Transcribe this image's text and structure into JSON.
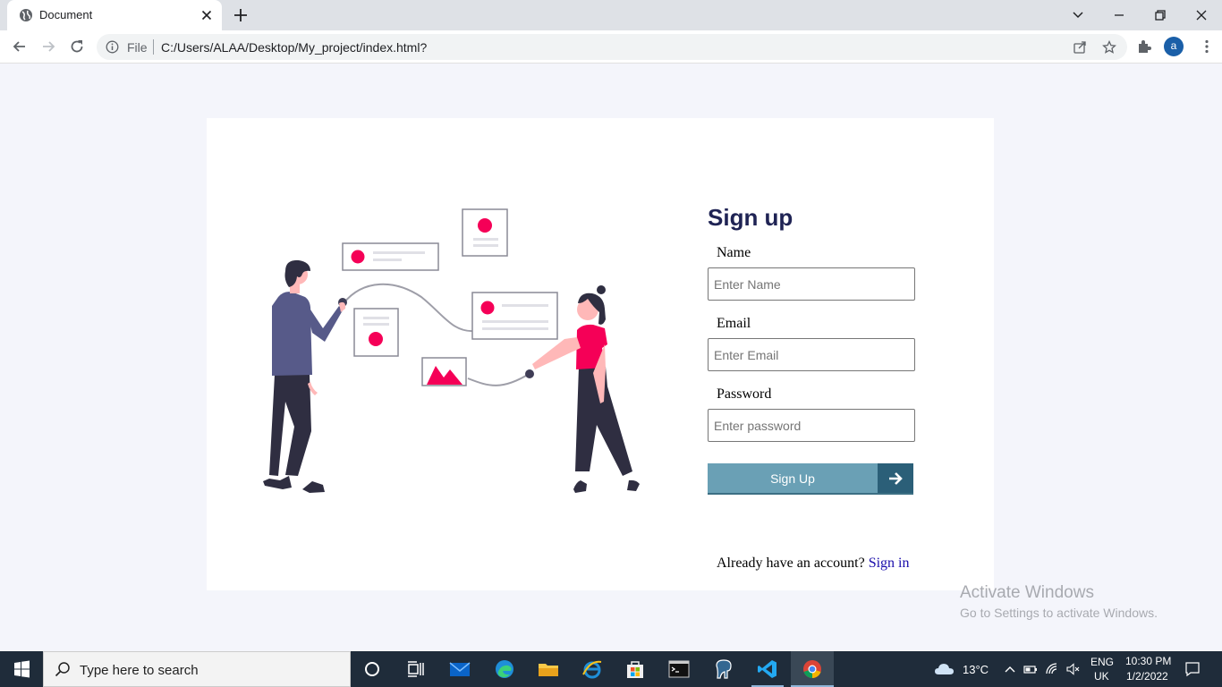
{
  "browser": {
    "tab_title": "Document",
    "url_scheme": "File",
    "url": "C:/Users/ALAA/Desktop/My_project/index.html?",
    "profile_initial": "a"
  },
  "form": {
    "heading": "Sign up",
    "name_label": "Name",
    "name_placeholder": "Enter Name",
    "email_label": "Email",
    "email_placeholder": "Enter Email",
    "password_label": "Password",
    "password_placeholder": "Enter password",
    "submit_label": "Sign Up",
    "signin_prompt": "Already have an account? ",
    "signin_link": "Sign in"
  },
  "watermark": {
    "title": "Activate Windows",
    "subtitle": "Go to Settings to activate Windows."
  },
  "taskbar": {
    "search_placeholder": "Type here to search",
    "temperature": "13°C",
    "language": "ENG",
    "region": "UK",
    "time": "10:30 PM",
    "date": "1/2/2022"
  },
  "colors": {
    "accent": "#f50057",
    "heading": "#1f2354",
    "button": "#6aa0b5",
    "button_dark": "#2b5f78"
  }
}
